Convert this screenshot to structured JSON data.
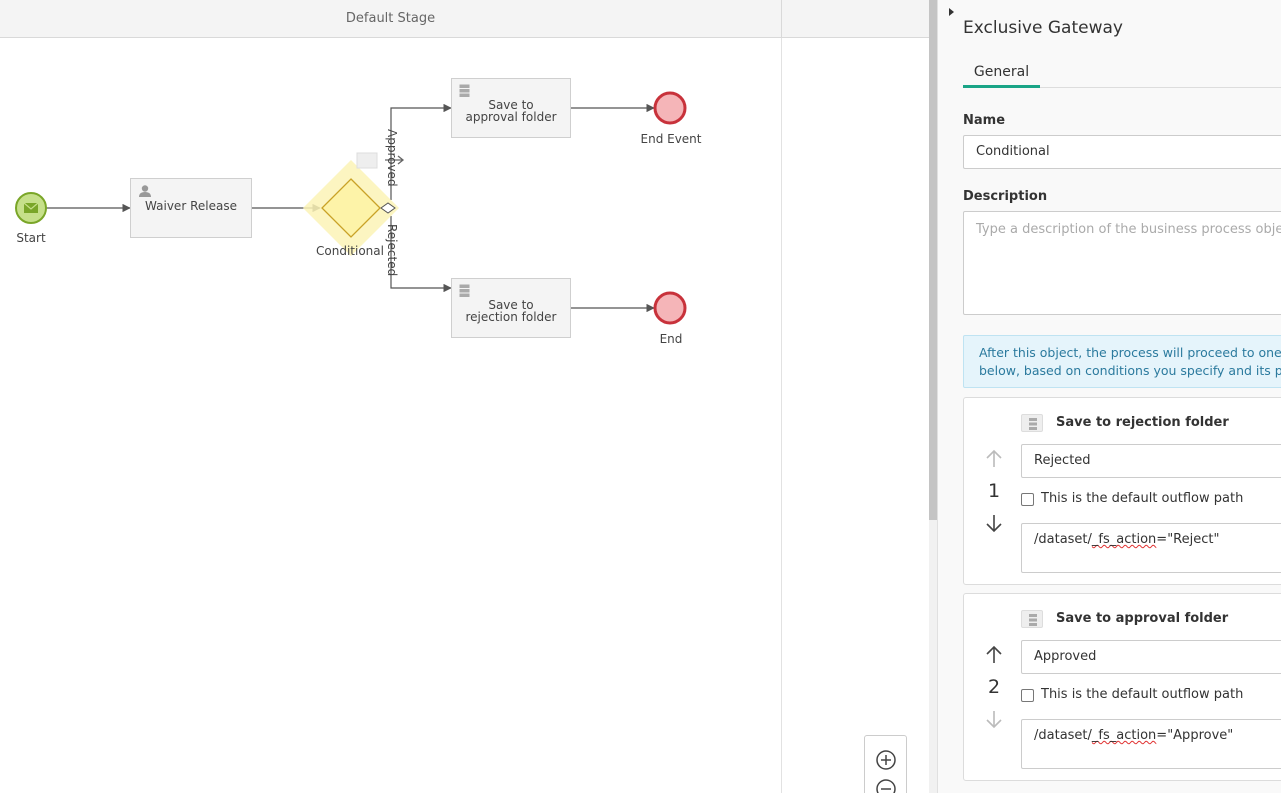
{
  "canvas": {
    "stage_title": "Default Stage",
    "nodes": {
      "start_label": "Start",
      "waiver_task_label": "Waiver Release",
      "gateway_label": "Conditional",
      "approval_task_label": "Save to approval folder",
      "rejection_task_label": "Save to rejection folder",
      "end_event_label": "End Event",
      "end_label": "End"
    },
    "flows": {
      "approved_label": "Approved",
      "rejected_label": "Rejected"
    }
  },
  "panel": {
    "title": "Exclusive Gateway",
    "tabs": [
      {
        "label": "General"
      }
    ],
    "name_label": "Name",
    "name_value": "Conditional",
    "description_label": "Description",
    "description_placeholder": "Type a description of the business process object.",
    "info_line1": "After this object, the process will proceed to one o",
    "info_line2": "below, based on conditions you specify and its pri",
    "outflows": [
      {
        "title": "Save to rejection folder",
        "order": "1",
        "label_value": "Rejected",
        "default_text": "This is the default outflow path",
        "expr_prefix": "/dataset/",
        "expr_squiggle": "_fs_action",
        "expr_suffix": "=\"Reject\""
      },
      {
        "title": "Save to approval folder",
        "order": "2",
        "label_value": "Approved",
        "default_text": "This is the default outflow path",
        "expr_prefix": "/dataset/",
        "expr_squiggle": "_fs_action",
        "expr_suffix": "=\"Approve\""
      }
    ]
  },
  "colors": {
    "accent": "#1aa587",
    "start_fill": "#c6e08a",
    "start_stroke": "#7aa628",
    "end_fill": "#f5b5b8",
    "end_stroke": "#c8323b",
    "gateway_fill": "#fdf3a8",
    "gateway_highlight": "#fcf3b6"
  }
}
